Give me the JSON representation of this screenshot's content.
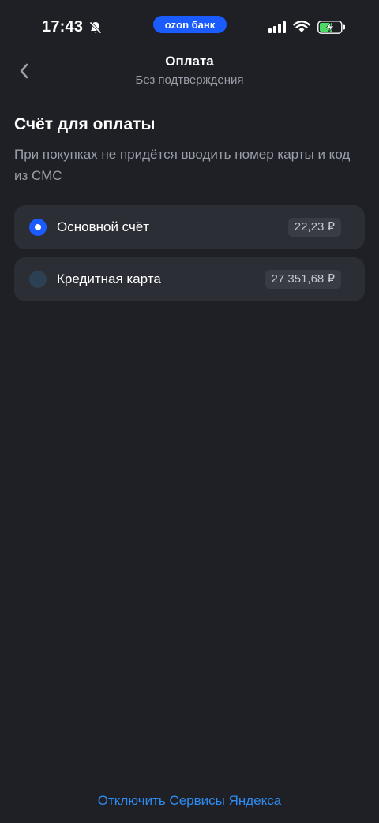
{
  "status_bar": {
    "time": "17:43",
    "carrier_pill": "ozon банк",
    "icons": [
      "bell-off-icon",
      "cellular-signal-icon",
      "wifi-icon",
      "battery-charging-icon"
    ]
  },
  "header": {
    "back_icon": "chevron-left-icon",
    "title": "Оплата",
    "subtitle": "Без подтверждения"
  },
  "section": {
    "title": "Счёт для оплаты",
    "description": "При покупках не придётся вводить номер карты и код из СМС"
  },
  "accounts": [
    {
      "label": "Основной счёт",
      "amount": "22,23 ₽",
      "selected": true
    },
    {
      "label": "Кредитная карта",
      "amount": "27 351,68 ₽",
      "selected": false
    }
  ],
  "footer": {
    "link": "Отключить Сервисы Яндекса"
  },
  "colors": {
    "background": "#1e2026",
    "card": "#2c2e35",
    "accent": "#1a5cff",
    "link": "#2e8cf0",
    "muted_text": "#9a9ea8"
  }
}
